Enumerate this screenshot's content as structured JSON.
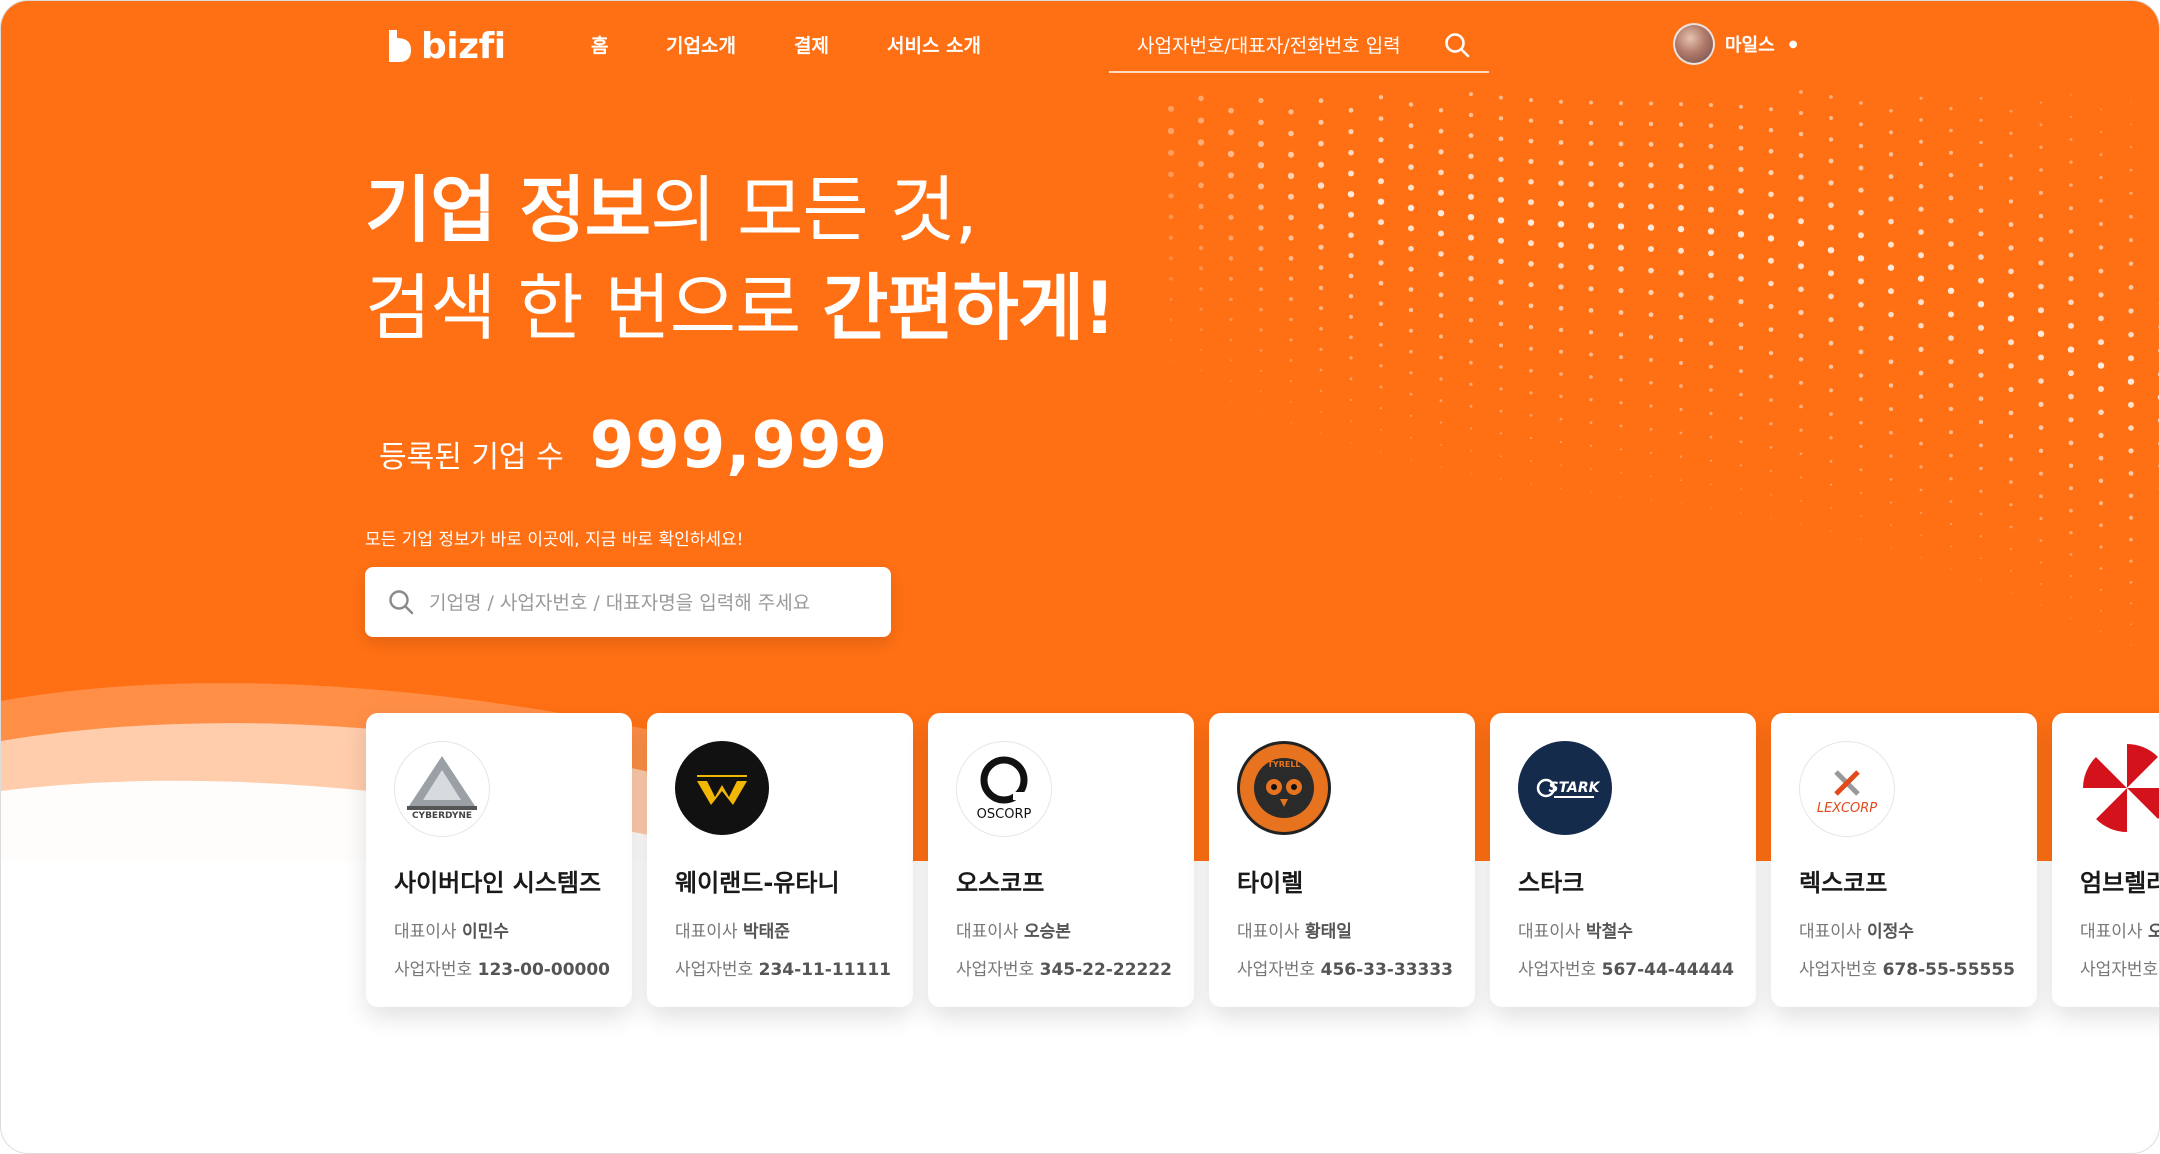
{
  "brand": {
    "name": "bizfi",
    "color": "#ff7014"
  },
  "nav": {
    "items": [
      {
        "label": "홈"
      },
      {
        "label": "기업소개"
      },
      {
        "label": "결제"
      },
      {
        "label": "서비스 소개"
      }
    ],
    "search": {
      "placeholder": "사업자번호/대표자/전화번호 입력",
      "icon": "search-icon"
    },
    "user": {
      "name": "마일스",
      "icon": "avatar"
    }
  },
  "hero": {
    "headline_line1_bold": "기업 정보",
    "headline_line1_rest": "의 모든 것,",
    "headline_line2_rest": "검색 한 번으로 ",
    "headline_line2_bold": "간편하게!",
    "count_label": "등록된 기업 수",
    "count_value": "999,999",
    "caption": "모든 기업 정보가 바로 이곳에, 지금 바로 확인하세요!",
    "search_placeholder": "기업명 / 사업자번호 / 대표자명을 입력해 주세요"
  },
  "cards": [
    {
      "name": "사이버다인 시스템즈",
      "ceo_label": "대표이사",
      "ceo": "이민수",
      "biz_label": "사업자번호",
      "biz_no": "123-00-00000",
      "logo_text": "CYBERDYNE",
      "logo": "cyberdyne-logo"
    },
    {
      "name": "웨이랜드-유타니",
      "ceo_label": "대표이사",
      "ceo": "박태준",
      "biz_label": "사업자번호",
      "biz_no": "234-11-11111",
      "logo_text": "",
      "logo": "weyland-yutani-logo"
    },
    {
      "name": "오스코프",
      "ceo_label": "대표이사",
      "ceo": "오승본",
      "biz_label": "사업자번호",
      "biz_no": "345-22-22222",
      "logo_text": "OSCORP",
      "logo": "oscorp-logo"
    },
    {
      "name": "타이렐",
      "ceo_label": "대표이사",
      "ceo": "황태일",
      "biz_label": "사업자번호",
      "biz_no": "456-33-33333",
      "logo_text": "TYRELL",
      "logo": "tyrell-logo"
    },
    {
      "name": "스타크",
      "ceo_label": "대표이사",
      "ceo": "박철수",
      "biz_label": "사업자번호",
      "biz_no": "567-44-44444",
      "logo_text": "STARK",
      "logo": "stark-logo"
    },
    {
      "name": "렉스코프",
      "ceo_label": "대표이사",
      "ceo": "이정수",
      "biz_label": "사업자번호",
      "biz_no": "678-55-55555",
      "logo_text": "LEXCORP",
      "logo": "lexcorp-logo"
    },
    {
      "name": "엄브렐라",
      "ceo_label": "대표이사",
      "ceo": "오",
      "biz_label": "사업자번호",
      "biz_no": "",
      "logo_text": "",
      "logo": "umbrella-logo"
    }
  ]
}
